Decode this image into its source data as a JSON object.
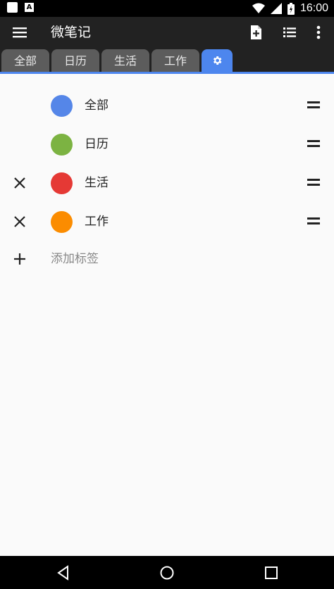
{
  "status_bar": {
    "time": "16:00",
    "notif_badge": "A"
  },
  "toolbar": {
    "title": "微笔记"
  },
  "tabs": [
    {
      "label": "全部"
    },
    {
      "label": "日历"
    },
    {
      "label": "生活"
    },
    {
      "label": "工作"
    },
    {
      "label": "",
      "icon": "gear-icon"
    }
  ],
  "labels": [
    {
      "name": "全部",
      "color": "#5586e8",
      "removable": false
    },
    {
      "name": "日历",
      "color": "#7cb342",
      "removable": false
    },
    {
      "name": "生活",
      "color": "#e53935",
      "removable": true
    },
    {
      "name": "工作",
      "color": "#fb8c00",
      "removable": true
    }
  ],
  "add_label": {
    "text": "添加标签"
  },
  "colors": {
    "accent": "#4d86ee",
    "toolbar_bg": "#222222",
    "tab_bg": "#5c5c5c"
  }
}
